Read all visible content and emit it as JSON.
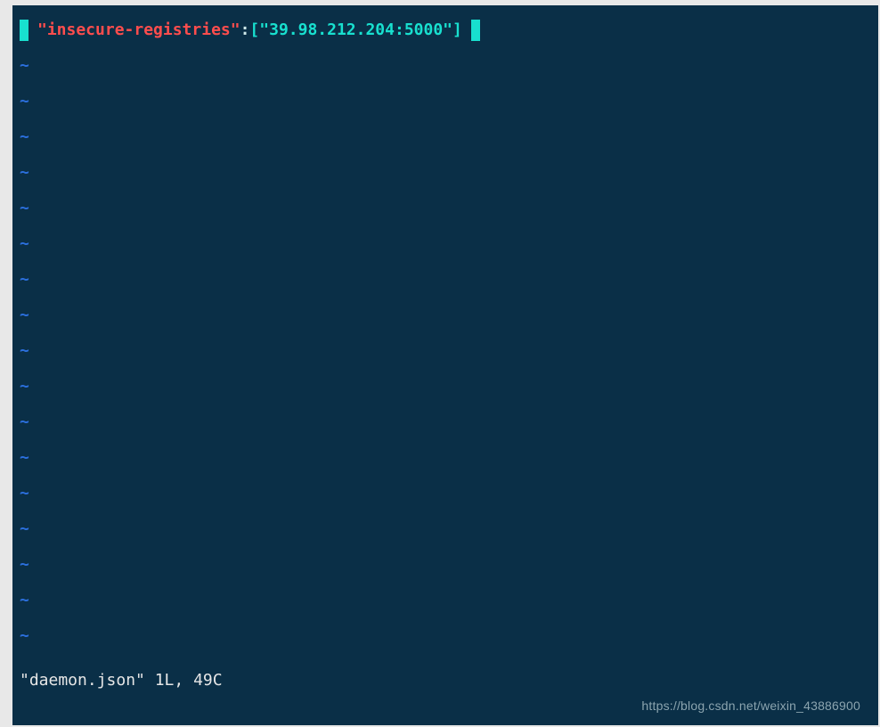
{
  "editor": {
    "line": {
      "brace_open": "{",
      "key": "\"insecure-registries\"",
      "colon": ":",
      "arr_open": "[",
      "value": "\"39.98.212.204:5000\"",
      "arr_close": "]",
      "brace_close": "}"
    },
    "tilde": "~",
    "tilde_count": 17,
    "status": "\"daemon.json\" 1L, 49C"
  },
  "watermark": "https://blog.csdn.net/weixin_43886900"
}
